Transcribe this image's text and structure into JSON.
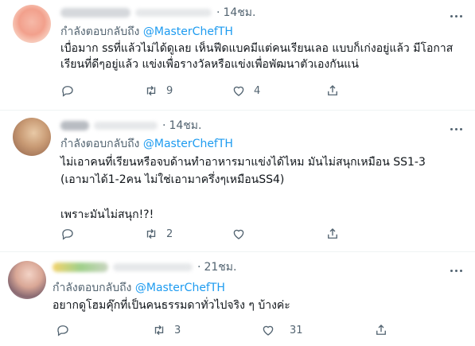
{
  "tweets": [
    {
      "time": "14ชม.",
      "reply_prefix": "กำลังตอบกลับถึง",
      "mention": "@MasterChefTH",
      "text": "เบื่อมาก ssที่แล้วไม่ได้ดูเลย เห็นฟีดแบคมีแต่คนเรียนเลอ แบบก็เก่งอยู่แล้ว มีโอกาส\nเรียนที่ดีๆอยู่แล้ว แข่งเพื่อรางวัลหรือแข่งเพื่อพัฒนาตัวเองกันแน่",
      "retweets": "9",
      "likes": "4"
    },
    {
      "time": "14ชม.",
      "reply_prefix": "กำลังตอบกลับถึง",
      "mention": "@MasterChefTH",
      "text": "ไม่เอาคนที่เรียนหรือจบด้านทำอาหารมาแข่งได้ไหม มันไม่สนุกเหมือน SS1-3\n(เอามาได้1-2คน ไม่ใช่เอามาครึ่งๆเหมือนSS4)\n\nเพราะมันไม่สนุก!?!",
      "retweets": "2",
      "likes": ""
    },
    {
      "time": "21ชม.",
      "reply_prefix": "กำลังตอบกลับถึง",
      "mention": "@MasterChefTH",
      "text": "อยากดูโฮมคุ๊กที่เป็นคนธรรมดาทั่วไปจริง ๆ บ้างค่ะ",
      "retweets": "3",
      "likes": "31"
    }
  ],
  "icons": {
    "more": "more-icon",
    "reply": "reply-icon",
    "retweet": "retweet-icon",
    "like": "like-icon",
    "share": "share-icon"
  },
  "colors": {
    "accent": "#1d9bf0",
    "secondary_text": "#536471",
    "divider": "#eff3f4"
  }
}
